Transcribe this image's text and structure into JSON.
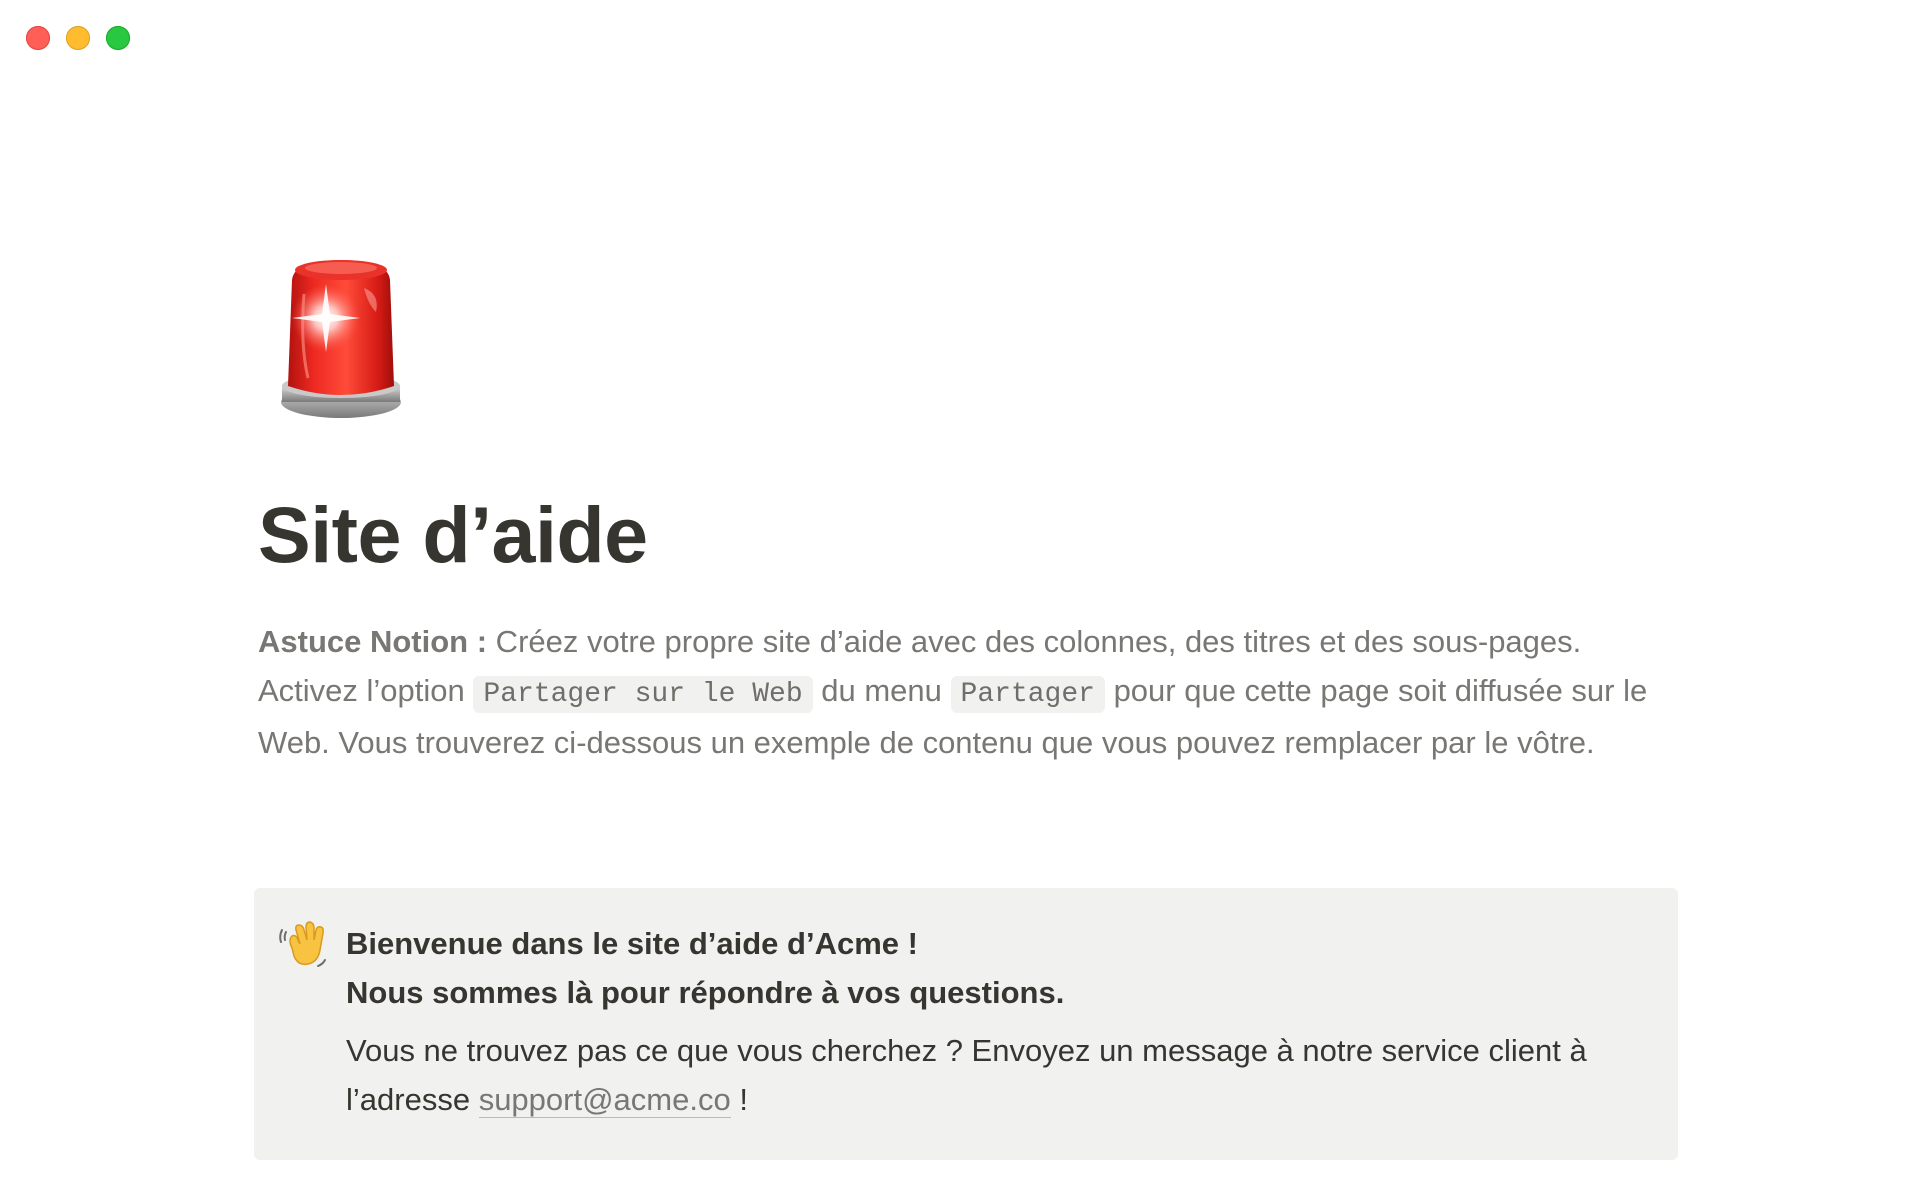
{
  "window": {
    "controls": [
      "close",
      "minimize",
      "maximize"
    ]
  },
  "page": {
    "icon": "police-light-emoji-icon",
    "title": "Site d’aide"
  },
  "intro": {
    "tip_label": "Astuce Notion :",
    "text_1": " Créez votre propre site d’aide avec des colonnes, des titres et des sous-pages. Activez l’option ",
    "code_1": "Partager sur le Web",
    "text_2": " du menu ",
    "code_2": "Partager",
    "text_3": " pour que cette page soit diffusée sur le Web. Vous trouverez ci-dessous un exemple de contenu que vous pouvez remplacer par le vôtre."
  },
  "callout": {
    "icon": "waving-hand-emoji-icon",
    "heading_line1": "Bienvenue dans le site d’aide d’Acme !",
    "heading_line2": "Nous sommes là pour répondre à vos questions.",
    "text_before_link": "Vous ne trouvez pas ce que vous cherchez ? Envoyez un message à notre service client à l’adresse ",
    "link_text": "support@acme.co",
    "text_after_link": " !"
  },
  "colors": {
    "close": "#ff5f57",
    "minimize": "#febc2e",
    "maximize": "#28c840",
    "title_text": "#37352f",
    "muted_text": "#787774",
    "callout_bg": "#f1f1ef"
  }
}
